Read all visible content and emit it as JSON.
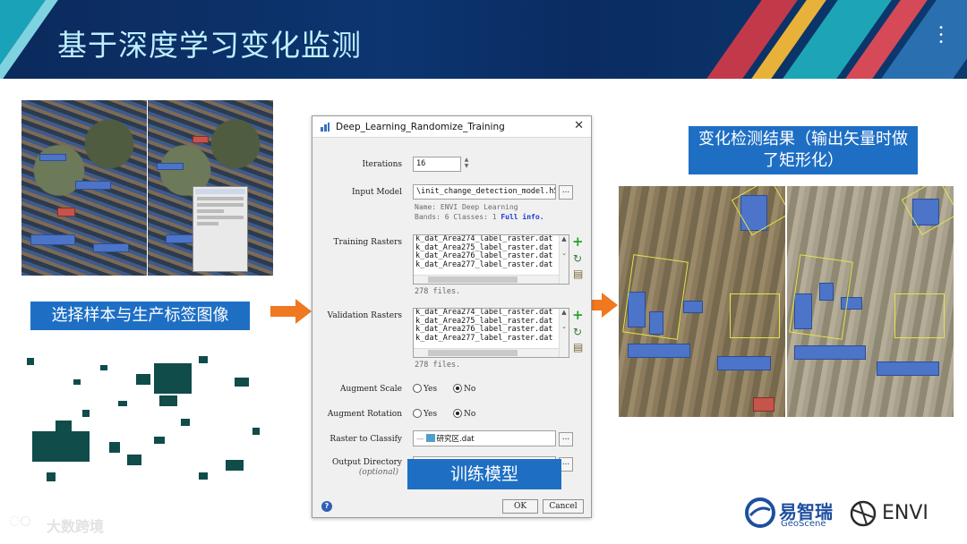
{
  "slide_title": "基于深度学习变化监测",
  "captions": {
    "left": "选择样本与生产标签图像",
    "right": "变化检测结果（输出矢量时做了矩形化）",
    "bottom": "训练模型"
  },
  "dialog": {
    "title": "Deep_Learning_Randomize_Training",
    "iterations_label": "Iterations",
    "iterations_value": "16",
    "input_model_label": "Input Model",
    "input_model_value": "\\init_change_detection_model.h5",
    "model_info_name": "Name:  ENVI Deep Learning",
    "model_info_bands": "Bands: 6  Classes: 1",
    "full_info_link": "Full info.",
    "training_label": "Training Rasters",
    "training_rows": [
      "k_dat_Area274_label_raster.dat",
      "k_dat_Area275_label_raster.dat",
      "k_dat_Area276_label_raster.dat",
      "k_dat_Area277_label_raster.dat"
    ],
    "training_count": "278 files.",
    "validation_label": "Validation Rasters",
    "validation_rows": [
      "k_dat_Area274_label_raster.dat",
      "k_dat_Area275_label_raster.dat",
      "k_dat_Area276_label_raster.dat",
      "k_dat_Area277_label_raster.dat"
    ],
    "validation_count": "278 files.",
    "augment_scale_label": "Augment Scale",
    "augment_rotation_label": "Augment Rotation",
    "yes": "Yes",
    "no": "No",
    "raster_classify_label": "Raster to Classify",
    "raster_classify_value": "研究区.dat",
    "output_dir_label": "Output Directory",
    "output_dir_optional": "(optional)",
    "ok": "OK",
    "cancel": "Cancel"
  },
  "logos": {
    "geoscene_cn": "易智瑞",
    "geoscene_en": "GeoScene",
    "envi": "ENVI",
    "watermark": "大数跨境"
  },
  "colors": {
    "banner": "#0b2a5c",
    "caption_blue": "#1e6fc4",
    "arrow_orange": "#f07820",
    "title_text": "#bfefff"
  }
}
